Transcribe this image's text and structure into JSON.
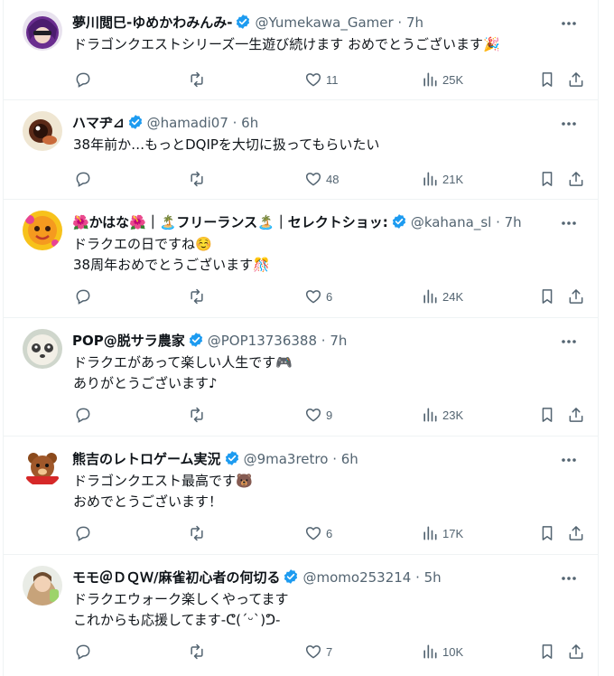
{
  "tweets": [
    {
      "name": "夢川閲巳-ゆめかわみんみ-",
      "handle": "@Yumekawa_Gamer",
      "time": "7h",
      "lines": [
        "ドラゴンクエストシリーズ一生遊び続けます おめでとうございます🎉"
      ],
      "replies": "",
      "reposts": "",
      "likes": "11",
      "views": "25K"
    },
    {
      "name": "ハマヂ⊿",
      "handle": "@hamadi07",
      "time": "6h",
      "lines": [
        "38年前か…もっとDQIPを大切に扱ってもらいたい"
      ],
      "replies": "",
      "reposts": "",
      "likes": "48",
      "views": "21K"
    },
    {
      "name": "🌺かはな🌺｜🏝️フリーランス🏝️｜セレクトショッ:",
      "handle": "@kahana_sl",
      "time": "7h",
      "lines": [
        "ドラクエの日ですね☺️",
        "38周年おめでとうございます🎊"
      ],
      "replies": "",
      "reposts": "",
      "likes": "6",
      "views": "24K"
    },
    {
      "name": "POP@脱サラ農家",
      "handle": "@POP13736388",
      "time": "7h",
      "lines": [
        "ドラクエがあって楽しい人生です🎮",
        "ありがとうございます♪"
      ],
      "replies": "",
      "reposts": "",
      "likes": "9",
      "views": "23K"
    },
    {
      "name": "熊吉のレトロゲーム実況",
      "handle": "@9ma3retro",
      "time": "6h",
      "lines": [
        "ドラゴンクエスト最高です🐻",
        "おめでとうございます！"
      ],
      "replies": "",
      "reposts": "",
      "likes": "6",
      "views": "17K"
    },
    {
      "name": "モモ＠ＤＱＷ/麻雀初心者の何切る",
      "handle": "@momo253214",
      "time": "5h",
      "lines": [
        "ドラクエウォーク楽しくやってます",
        "これからも応援してます-ᕦ(ˊᵕˋ)ᕤ-"
      ],
      "replies": "",
      "reposts": "",
      "likes": "7",
      "views": "10K"
    }
  ],
  "colors": {
    "text": "#0f1419",
    "secondary": "#536471",
    "verified": "#1d9bf0",
    "divider": "#eff3f4"
  },
  "icons": [
    "verified-badge-icon",
    "more-icon",
    "reply-icon",
    "repost-icon",
    "like-icon",
    "views-icon",
    "bookmark-icon",
    "share-icon"
  ]
}
